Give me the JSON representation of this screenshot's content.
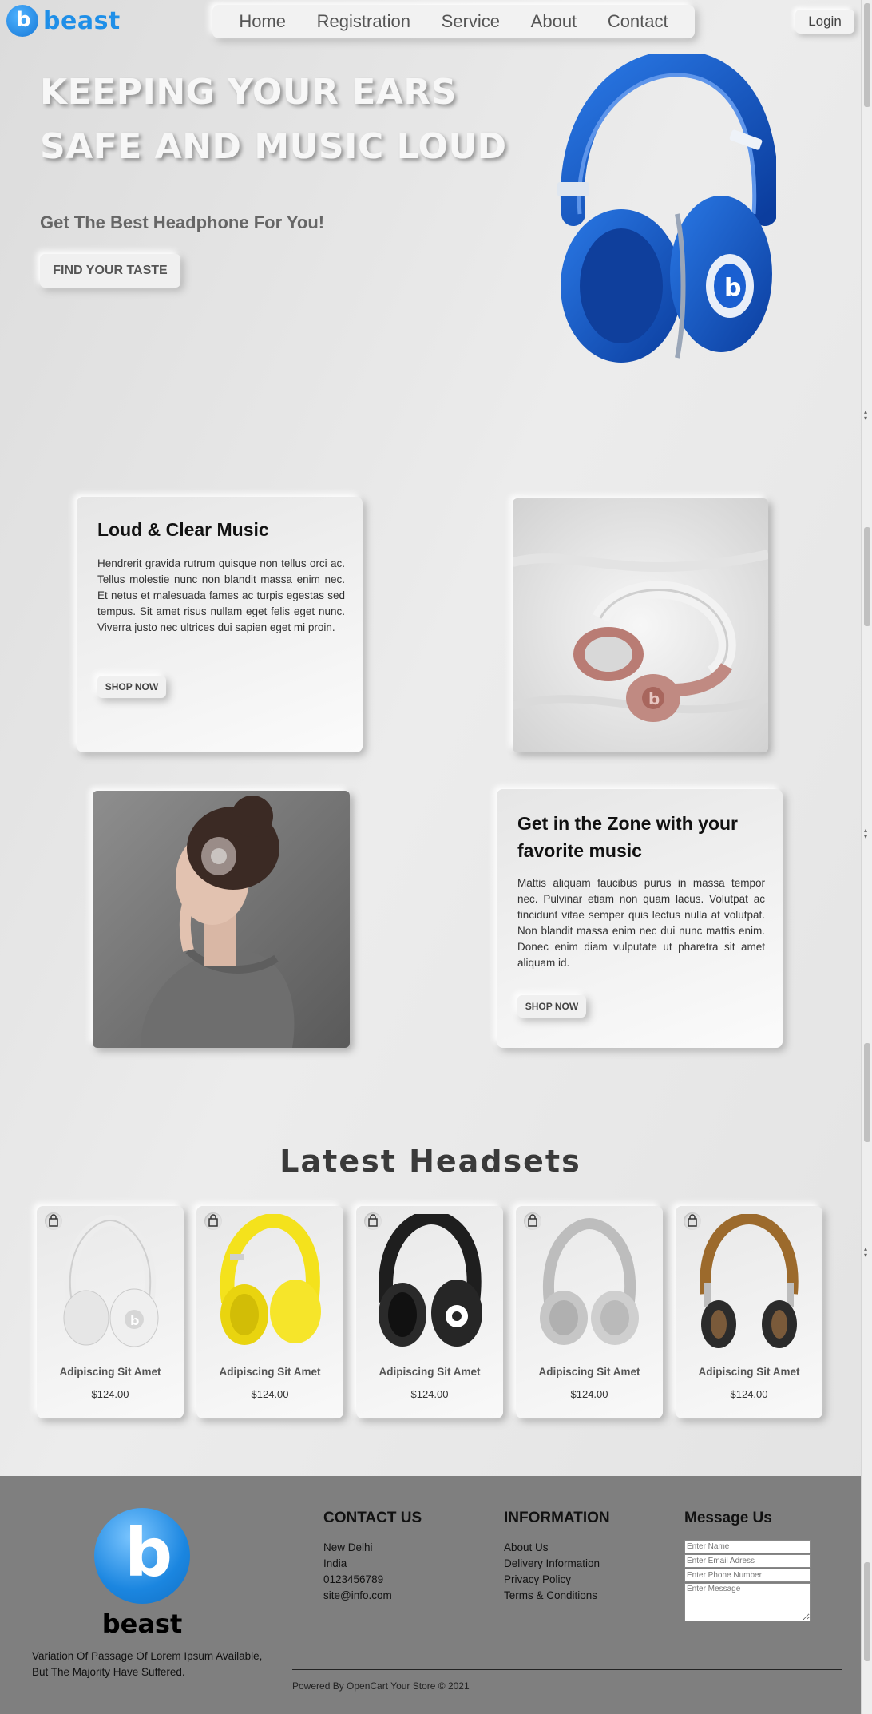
{
  "brand": {
    "name": "beast",
    "letter": "b",
    "color": "#1f8fe8"
  },
  "nav": {
    "items": [
      "Home",
      "Registration",
      "Service",
      "About",
      "Contact"
    ],
    "login_label": "Login"
  },
  "hero": {
    "title_line1": "KEEPING YOUR EARS",
    "title_line2": "SAFE AND MUSIC LOUD",
    "subtitle": "Get The Best Headphone For You!",
    "cta_label": "FIND YOUR TASTE"
  },
  "features": [
    {
      "title": "Loud & Clear Music",
      "text": "Hendrerit gravida rutrum quisque non tellus orci ac. Tellus molestie nunc non blandit massa enim nec. Et netus et malesuada fames ac turpis egestas sed tempus. Sit amet risus nullam eget felis eget nunc. Viverra justo nec ultrices dui sapien eget mi proin.",
      "button_label": "SHOP NOW"
    },
    {
      "title": "Get in the Zone with your favorite music",
      "text": "Mattis aliquam faucibus purus in massa tempor nec. Pulvinar etiam non quam lacus. Volutpat ac tincidunt vitae semper quis lectus nulla at volutpat. Non blandit massa enim nec dui nunc mattis enim. Donec enim diam vulputate ut pharetra sit amet aliquam id.",
      "button_label": "SHOP NOW"
    }
  ],
  "latest": {
    "title": "Latest Headsets",
    "products": [
      {
        "name": "Adipiscing Sit Amet",
        "price": "$124.00",
        "color": "white"
      },
      {
        "name": "Adipiscing Sit Amet",
        "price": "$124.00",
        "color": "yellow"
      },
      {
        "name": "Adipiscing Sit Amet",
        "price": "$124.00",
        "color": "black"
      },
      {
        "name": "Adipiscing Sit Amet",
        "price": "$124.00",
        "color": "grey"
      },
      {
        "name": "Adipiscing Sit Amet",
        "price": "$124.00",
        "color": "brown"
      }
    ]
  },
  "footer": {
    "brand_name": "beast",
    "description": "Variation Of Passage Of Lorem Ipsum Available, But The Majority Have Suffered.",
    "contact": {
      "heading": "CONTACT US",
      "lines": [
        "New Delhi",
        "India",
        "0123456789",
        "site@info.com"
      ]
    },
    "information": {
      "heading": "INFORMATION",
      "links": [
        "About Us",
        "Delivery Information",
        "Privacy Policy",
        "Terms & Conditions"
      ]
    },
    "message": {
      "heading": "Message Us",
      "name_placeholder": "Enter Name",
      "email_placeholder": "Enter Email Adress",
      "phone_placeholder": "Enter Phone Number",
      "message_placeholder": "Enter Message"
    },
    "powered_by": "Powered By OpenCart Your Store © 2021"
  }
}
